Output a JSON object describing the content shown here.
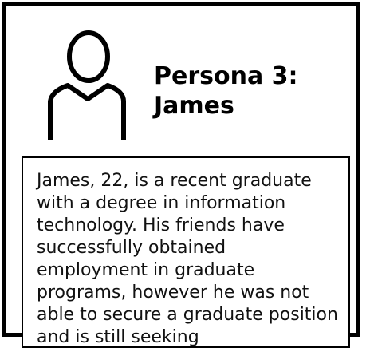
{
  "persona": {
    "title": "Persona 3: James",
    "avatar_icon": "person-outline-icon",
    "bio": "James, 22, is a recent graduate with a degree in information technology. His friends have successfully obtained employment in graduate programs, however he was not able to secure a graduate position and is still seeking"
  },
  "colors": {
    "border": "#000000",
    "text": "#111111",
    "background": "#ffffff"
  }
}
